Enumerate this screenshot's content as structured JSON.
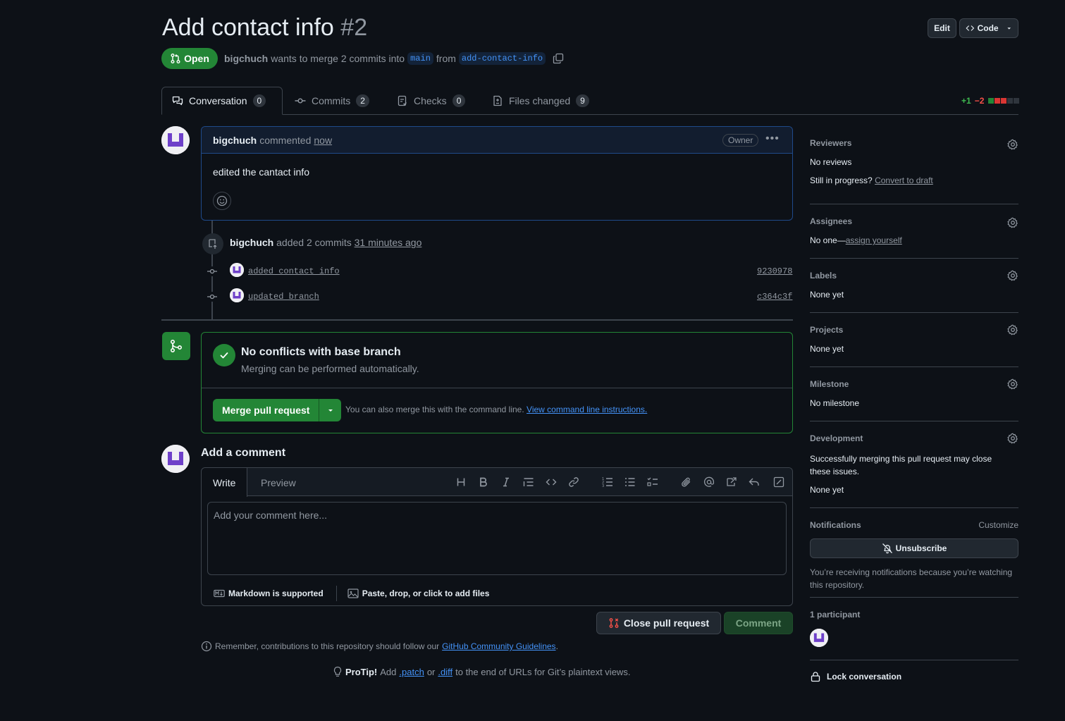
{
  "header": {
    "title": "Add contact info",
    "number": "#2",
    "edit_label": "Edit",
    "code_label": "Code",
    "state": "Open",
    "author": "bigchuch",
    "merge_text": "wants to merge 2 commits into",
    "base_branch": "main",
    "from_text": "from",
    "head_branch": "add-contact-info"
  },
  "tabs": [
    {
      "label": "Conversation",
      "count": "0"
    },
    {
      "label": "Commits",
      "count": "2"
    },
    {
      "label": "Checks",
      "count": "0"
    },
    {
      "label": "Files changed",
      "count": "9"
    }
  ],
  "diffstat": {
    "additions": "+1",
    "deletions": "−2",
    "blocks": [
      "#238636",
      "#da3633",
      "#da3633",
      "#2f353d",
      "#2f353d"
    ]
  },
  "comment": {
    "author": "bigchuch",
    "action": "commented",
    "time": "now",
    "role": "Owner",
    "body": "edited the cantact info"
  },
  "commits_event": {
    "author": "bigchuch",
    "text": "added 2 commits",
    "time": "31 minutes ago",
    "commits": [
      {
        "message": "added contact info",
        "sha": "9230978"
      },
      {
        "message": "updated branch",
        "sha": "c364c3f"
      }
    ]
  },
  "merge": {
    "title": "No conflicts with base branch",
    "subtitle": "Merging can be performed automatically.",
    "button": "Merge pull request",
    "hint": "You can also merge this with the command line.",
    "hint_link": "View command line instructions."
  },
  "add_comment": {
    "title": "Add a comment",
    "write_tab": "Write",
    "preview_tab": "Preview",
    "placeholder": "Add your comment here...",
    "markdown_note": "Markdown is supported",
    "files_note": "Paste, drop, or click to add files",
    "close_button": "Close pull request",
    "comment_button": "Comment"
  },
  "footer": {
    "guidelines_prefix": "Remember, contributions to this repository should follow our",
    "guidelines_link": "GitHub Community Guidelines",
    "guidelines_suffix": ".",
    "protip_label": "ProTip!",
    "protip_add": "Add",
    "protip_patch": ".patch",
    "protip_or": "or",
    "protip_diff": ".diff",
    "protip_rest": "to the end of URLs for Git’s plaintext views."
  },
  "sidebar": {
    "reviewers": {
      "heading": "Reviewers",
      "value": "No reviews",
      "progress_text": "Still in progress?",
      "draft_link": "Convert to draft"
    },
    "assignees": {
      "heading": "Assignees",
      "value": "No one—",
      "link": "assign yourself"
    },
    "labels": {
      "heading": "Labels",
      "value": "None yet"
    },
    "projects": {
      "heading": "Projects",
      "value": "None yet"
    },
    "milestone": {
      "heading": "Milestone",
      "value": "No milestone"
    },
    "development": {
      "heading": "Development",
      "description": "Successfully merging this pull request may close these issues.",
      "value": "None yet"
    },
    "notifications": {
      "heading": "Notifications",
      "customize": "Customize",
      "button": "Unsubscribe",
      "description": "You’re receiving notifications because you’re watching this repository."
    },
    "participants": {
      "heading": "1 participant"
    },
    "lock": "Lock conversation"
  }
}
